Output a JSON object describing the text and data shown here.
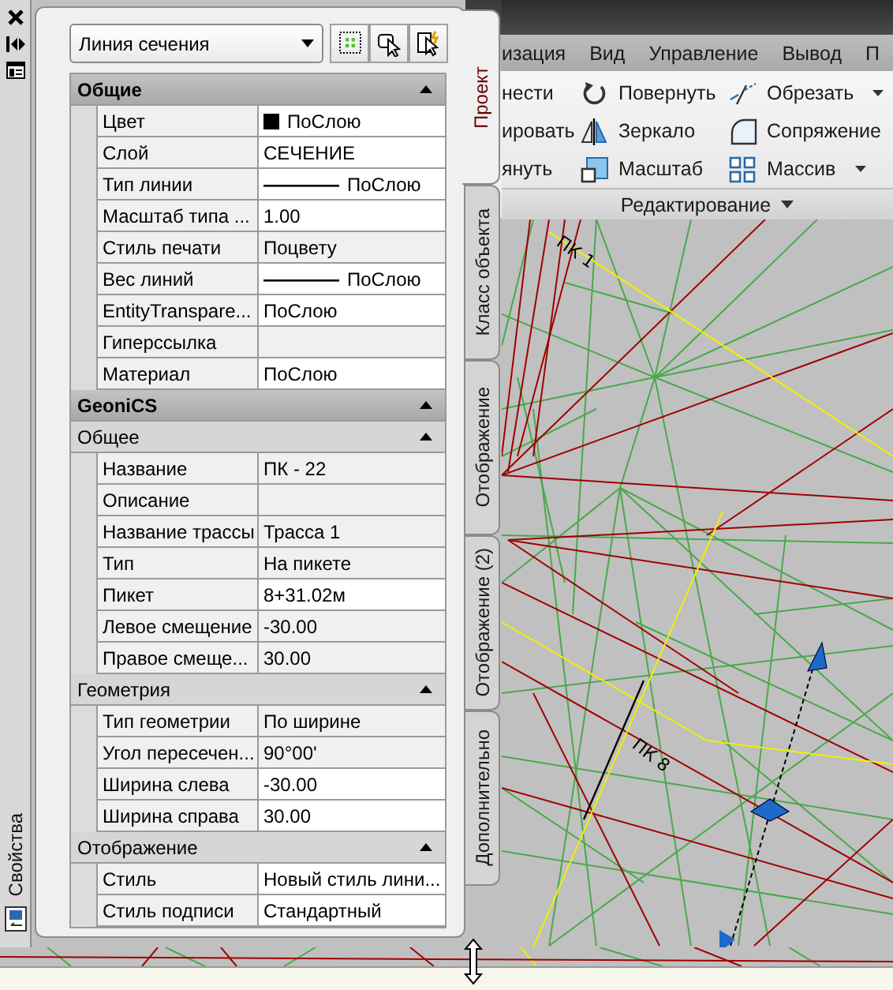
{
  "side_bar": {
    "title": "Свойства"
  },
  "palette": {
    "object_type": "Линия сечения",
    "sections": [
      {
        "title": "Общие",
        "expanded": true,
        "rows": [
          {
            "name": "Цвет",
            "value": "ПоСлою",
            "kind": "color",
            "color": "#000000",
            "readonly": false
          },
          {
            "name": "Слой",
            "value": "СЕЧЕНИЕ",
            "kind": "text",
            "readonly": false
          },
          {
            "name": "Тип линии",
            "value": "ПоСлою",
            "kind": "line",
            "readonly": false
          },
          {
            "name": "Масштаб типа ...",
            "value": "1.00",
            "kind": "text",
            "readonly": false
          },
          {
            "name": "Стиль печати",
            "value": "Поцвету",
            "kind": "text",
            "readonly": true
          },
          {
            "name": "Вес линий",
            "value": "ПоСлою",
            "kind": "line",
            "readonly": false
          },
          {
            "name": "EntityTranspare...",
            "value": "ПоСлою",
            "kind": "text",
            "readonly": false
          },
          {
            "name": "Гиперссылка",
            "kind": "text",
            "readonly": true
          },
          {
            "name": "Материал",
            "value": "ПоСлою",
            "kind": "text",
            "readonly": false
          }
        ]
      },
      {
        "title": "GeoniCS",
        "expanded": true,
        "groups": [
          {
            "title": "Общее",
            "expanded": true,
            "rows": [
              {
                "name": "Название",
                "value": "ПК - 22",
                "kind": "text",
                "readonly": true
              },
              {
                "name": "Описание",
                "kind": "text",
                "readonly": true
              },
              {
                "name": "Название трассы",
                "value": "Трасса 1",
                "kind": "text",
                "readonly": true
              },
              {
                "name": "Тип",
                "value": "На пикете",
                "kind": "text",
                "readonly": true
              },
              {
                "name": "Пикет",
                "value": "8+31.02м",
                "kind": "text",
                "readonly": false
              },
              {
                "name": "Левое смещение",
                "value": "-30.00",
                "kind": "text",
                "readonly": true
              },
              {
                "name": "Правое смеще...",
                "value": "30.00",
                "kind": "text",
                "readonly": true
              }
            ]
          },
          {
            "title": "Геометрия",
            "expanded": true,
            "rows": [
              {
                "name": "Тип геометрии",
                "value": "По ширине",
                "kind": "text",
                "readonly": true
              },
              {
                "name": "Угол пересечен...",
                "value": "90°00'",
                "kind": "text",
                "readonly": true
              },
              {
                "name": "Ширина слева",
                "value": "-30.00",
                "kind": "text",
                "readonly": false
              },
              {
                "name": "Ширина справа",
                "value": "30.00",
                "kind": "text",
                "readonly": false
              }
            ]
          },
          {
            "title": "Отображение",
            "expanded": true,
            "rows": [
              {
                "name": "Стиль",
                "value": "Новый стиль лини...",
                "kind": "text",
                "readonly": false
              },
              {
                "name": "Стиль подписи",
                "value": "Стандартный",
                "kind": "text",
                "readonly": false
              }
            ]
          }
        ]
      }
    ]
  },
  "side_tabs": [
    {
      "label": "Проект",
      "selected": true
    },
    {
      "label": "Класс объекта",
      "selected": false
    },
    {
      "label": "Отображение",
      "selected": false
    },
    {
      "label": "Отображение (2)",
      "selected": false
    },
    {
      "label": "Дополнительно",
      "selected": false
    }
  ],
  "ribbon": {
    "tabs": [
      "изация",
      "Вид",
      "Управление",
      "Вывод",
      "П"
    ],
    "buttons": [
      {
        "label": "нести",
        "has_menu": false
      },
      {
        "label": "ировать",
        "has_menu": false
      },
      {
        "label": "януть",
        "has_menu": false
      },
      {
        "label": "Повернуть",
        "has_menu": false
      },
      {
        "label": "Зеркало",
        "has_menu": false
      },
      {
        "label": "Масштаб",
        "has_menu": false
      },
      {
        "label": "Обрезать",
        "has_menu": true
      },
      {
        "label": "Сопряжение",
        "has_menu": false
      },
      {
        "label": "Массив",
        "has_menu": true
      }
    ],
    "panel_title": "Редактирование"
  },
  "canvas": {
    "labels": [
      "ПК 1",
      "ПК 8"
    ]
  }
}
